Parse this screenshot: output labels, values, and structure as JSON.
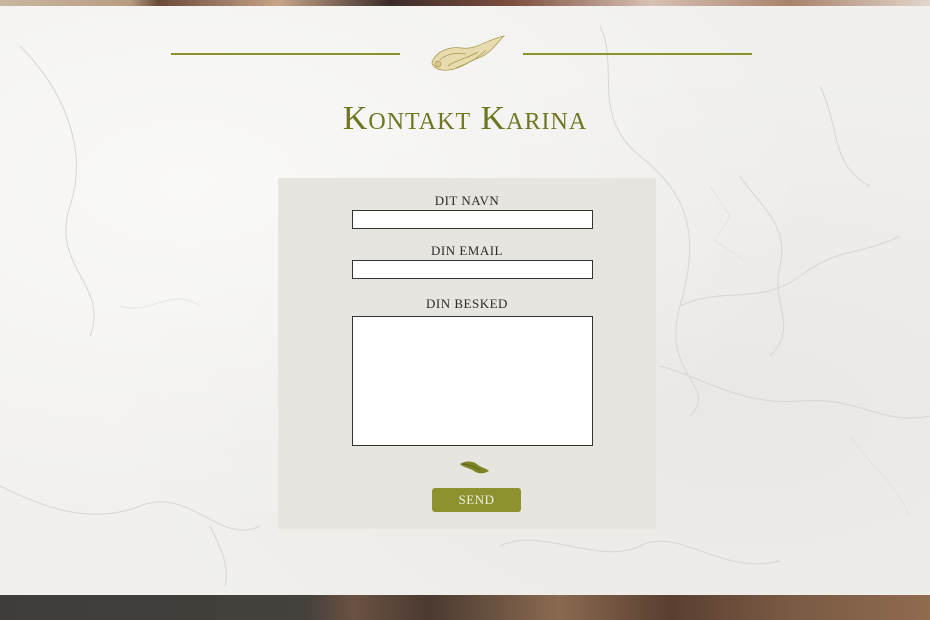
{
  "page": {
    "title": "Kontakt Karina"
  },
  "form": {
    "name_label": "DIT NAVN",
    "name_value": "",
    "email_label": "DIN EMAIL",
    "email_value": "",
    "message_label": "DIN BESKED",
    "message_value": "",
    "send_label": "SEND"
  },
  "colors": {
    "accent": "#8c922e",
    "title": "#6f7521",
    "panel": "#e7e5e0",
    "background": "#f1f0ed"
  },
  "icons": {
    "header_ornament": "acanthus-leaf-ornament-icon",
    "form_ornament": "leaf-ornament-icon"
  }
}
